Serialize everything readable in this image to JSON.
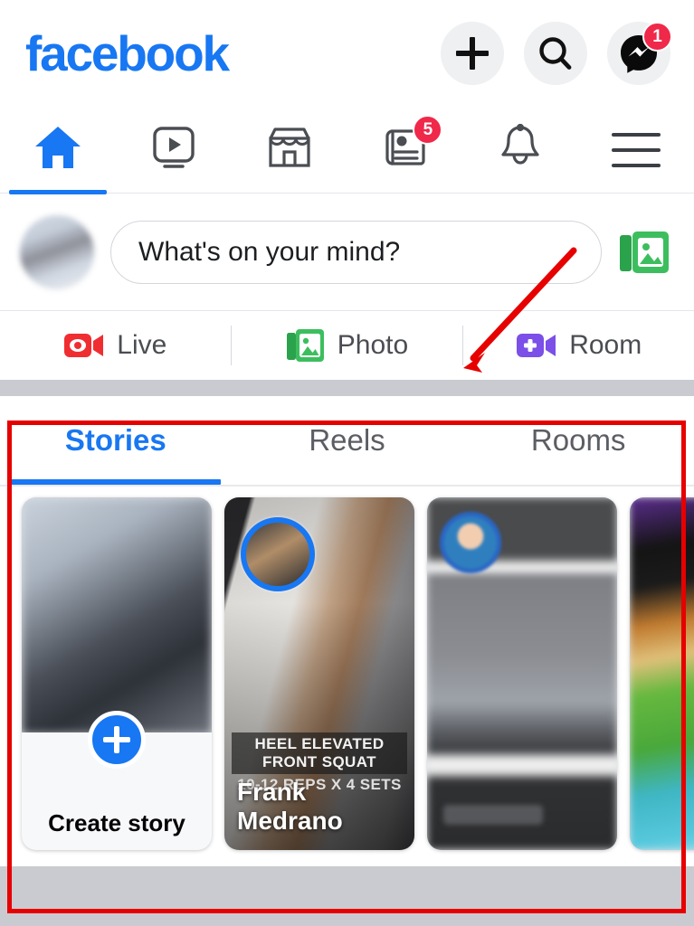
{
  "app": {
    "name": "Facebook",
    "brand_color": "#1877F2",
    "badge_color": "#F02849",
    "annotation_color": "#E60000"
  },
  "header": {
    "logo_text": "facebook",
    "actions": [
      {
        "name": "create-button",
        "icon": "plus-icon",
        "badge": null
      },
      {
        "name": "search-button",
        "icon": "search-icon",
        "badge": null
      },
      {
        "name": "messenger-button",
        "icon": "messenger-icon",
        "badge": "1"
      }
    ]
  },
  "navtabs": [
    {
      "label": "Home",
      "icon": "home-icon",
      "active": true,
      "badge": null
    },
    {
      "label": "Watch",
      "icon": "video-icon",
      "active": false,
      "badge": null
    },
    {
      "label": "Marketplace",
      "icon": "store-icon",
      "active": false,
      "badge": null
    },
    {
      "label": "News",
      "icon": "news-feed-icon",
      "active": false,
      "badge": "5"
    },
    {
      "label": "Notifications",
      "icon": "bell-icon",
      "active": false,
      "badge": null
    },
    {
      "label": "Menu",
      "icon": "hamburger-menu-icon",
      "active": false,
      "badge": null
    }
  ],
  "composer": {
    "placeholder": "What's on your mind?",
    "avatar_name": "user-avatar",
    "gallery_icon": "photo-gallery-icon"
  },
  "action_row": [
    {
      "label": "Live",
      "icon": "live-video-icon",
      "color": "#F02E31"
    },
    {
      "label": "Photo",
      "icon": "photo-icon",
      "color": "#45BD62"
    },
    {
      "label": "Room",
      "icon": "room-video-icon",
      "color": "#7B4FE8"
    }
  ],
  "stories": {
    "tabs": [
      {
        "label": "Stories",
        "active": true
      },
      {
        "label": "Reels",
        "active": false
      },
      {
        "label": "Rooms",
        "active": false
      }
    ],
    "cards": [
      {
        "type": "create",
        "label": "Create story",
        "plus_icon": "plus-icon"
      },
      {
        "type": "story",
        "name": "Frank Medrano",
        "caption_line1": "HEEL ELEVATED FRONT SQUAT",
        "caption_line2": "10-12 REPS X 4 SETS",
        "avatar_ring": true
      },
      {
        "type": "story",
        "name": "",
        "avatar_ring": true
      },
      {
        "type": "story",
        "name": "",
        "avatar_ring": false
      }
    ]
  }
}
